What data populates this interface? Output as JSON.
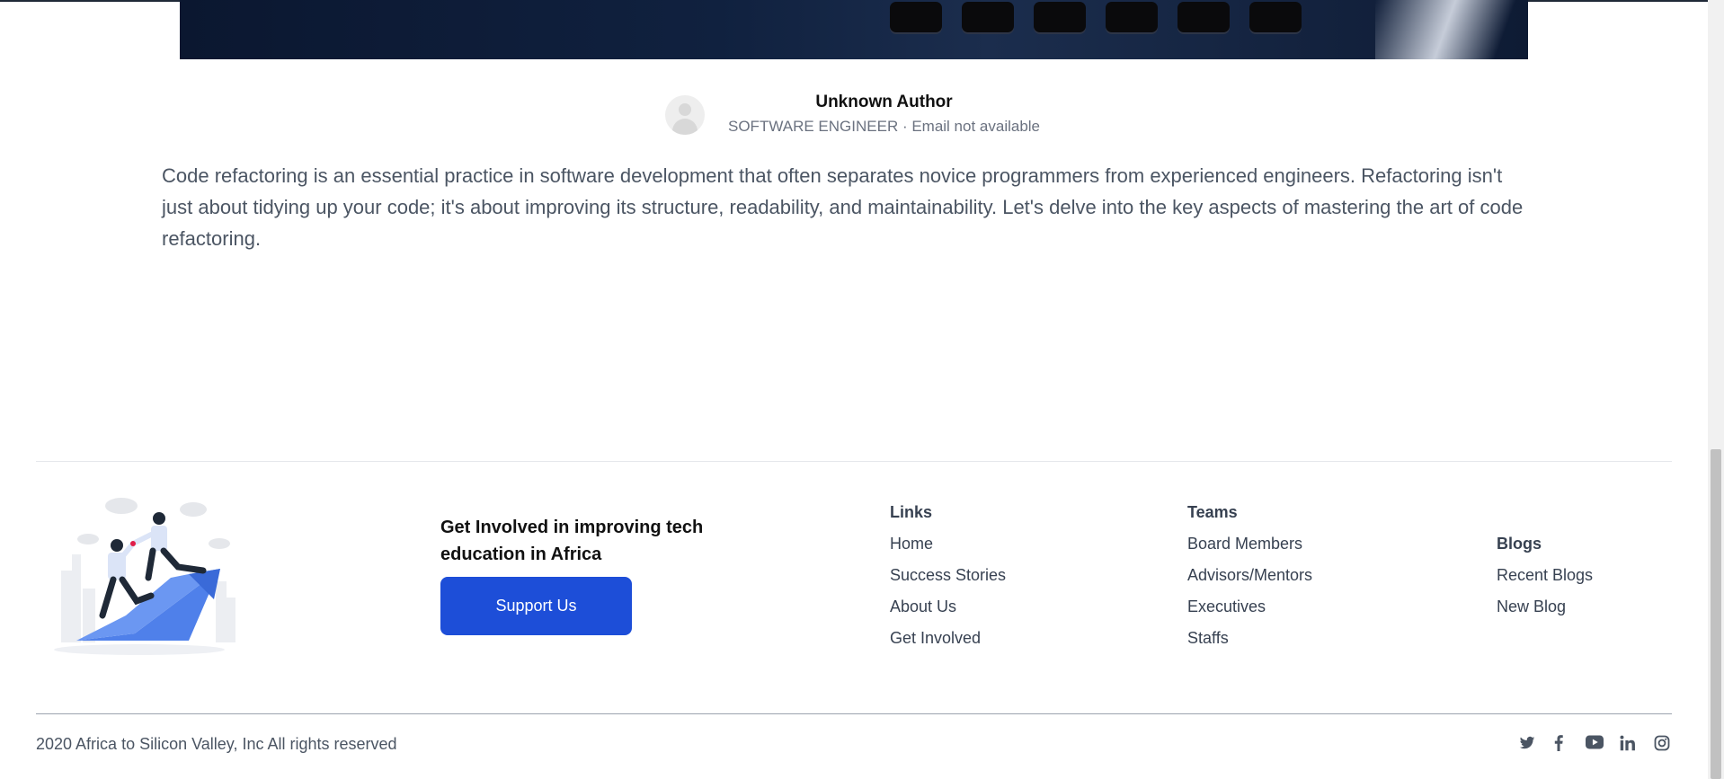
{
  "author": {
    "name": "Unknown Author",
    "meta": "SOFTWARE ENGINEER · Email not available"
  },
  "article": {
    "body": "Code refactoring is an essential practice in software development that often separates novice programmers from experienced engineers. Refactoring isn't just about tidying up your code; it's about improving its structure, readability, and maintainability. Let's delve into the key aspects of mastering the art of code refactoring."
  },
  "footer": {
    "cta_title": "Get Involved in improving tech education in Africa",
    "support_label": "Support Us",
    "links": {
      "heading": "Links",
      "items": [
        "Home",
        "Success Stories",
        "About Us",
        "Get Involved"
      ]
    },
    "teams": {
      "heading": "Teams",
      "items": [
        "Board Members",
        "Advisors/Mentors",
        "Executives",
        "Staffs"
      ]
    },
    "blogs": {
      "heading": "Blogs",
      "items": [
        "Recent Blogs",
        "New Blog"
      ]
    },
    "copyright": "2020 Africa to Silicon Valley, Inc All rights reserved",
    "social_icons": [
      "twitter-icon",
      "facebook-icon",
      "youtube-icon",
      "linkedin-icon",
      "instagram-icon"
    ]
  },
  "colors": {
    "accent": "#1d4ed8",
    "text_muted": "#4b5563"
  }
}
